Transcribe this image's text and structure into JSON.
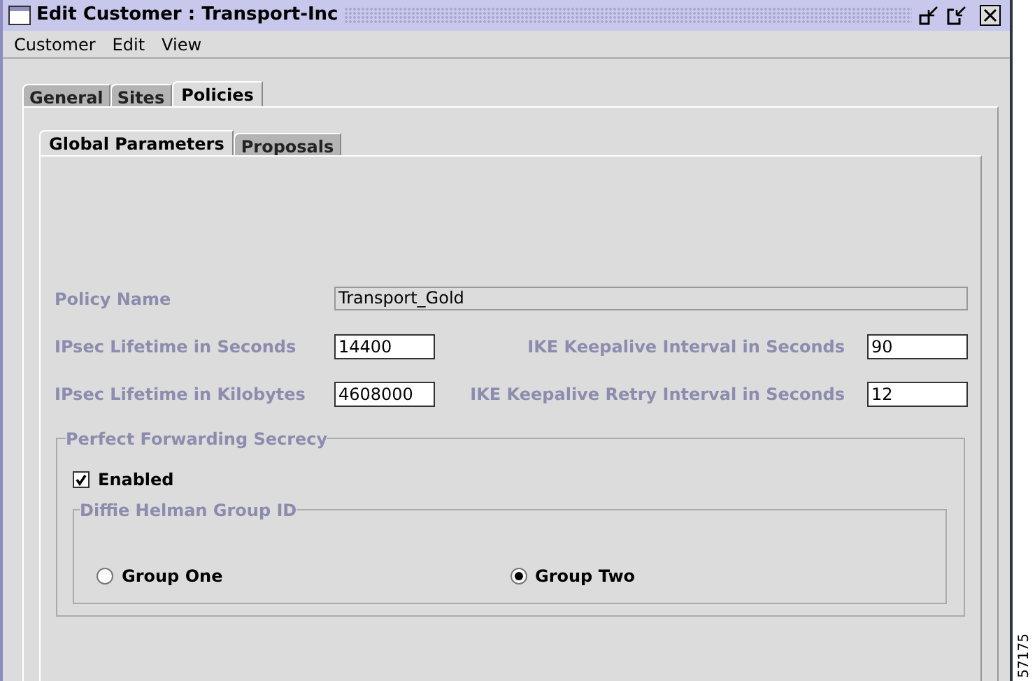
{
  "window": {
    "title": "Edit Customer : Transport-Inc"
  },
  "menu": [
    "Customer",
    "Edit",
    "View"
  ],
  "tabs": [
    {
      "label": "General",
      "selected": false
    },
    {
      "label": "Sites",
      "selected": false
    },
    {
      "label": "Policies",
      "selected": true
    }
  ],
  "subtabs": [
    {
      "label": "Global Parameters",
      "selected": true
    },
    {
      "label": "Proposals",
      "selected": false
    }
  ],
  "policy_name": {
    "label": "Policy Name",
    "value": "Transport_Gold"
  },
  "rows": [
    {
      "left": {
        "label": "IPsec Lifetime in Seconds",
        "value": "14400"
      },
      "right": {
        "label": "IKE Keepalive Interval in Seconds",
        "value": "90"
      }
    },
    {
      "left": {
        "label": "IPsec Lifetime in Kilobytes",
        "value": "4608000"
      },
      "right": {
        "label": "IKE Keepalive Retry Interval in Seconds",
        "value": "12"
      }
    }
  ],
  "pfs": {
    "title": "Perfect Forwarding Secrecy",
    "enabled": {
      "label": "Enabled",
      "checked": true
    },
    "dh": {
      "title": "Diffie Helman Group ID",
      "options": [
        {
          "label": "Group One",
          "selected": false
        },
        {
          "label": "Group Two",
          "selected": true
        }
      ]
    }
  },
  "figure_number": "57175"
}
